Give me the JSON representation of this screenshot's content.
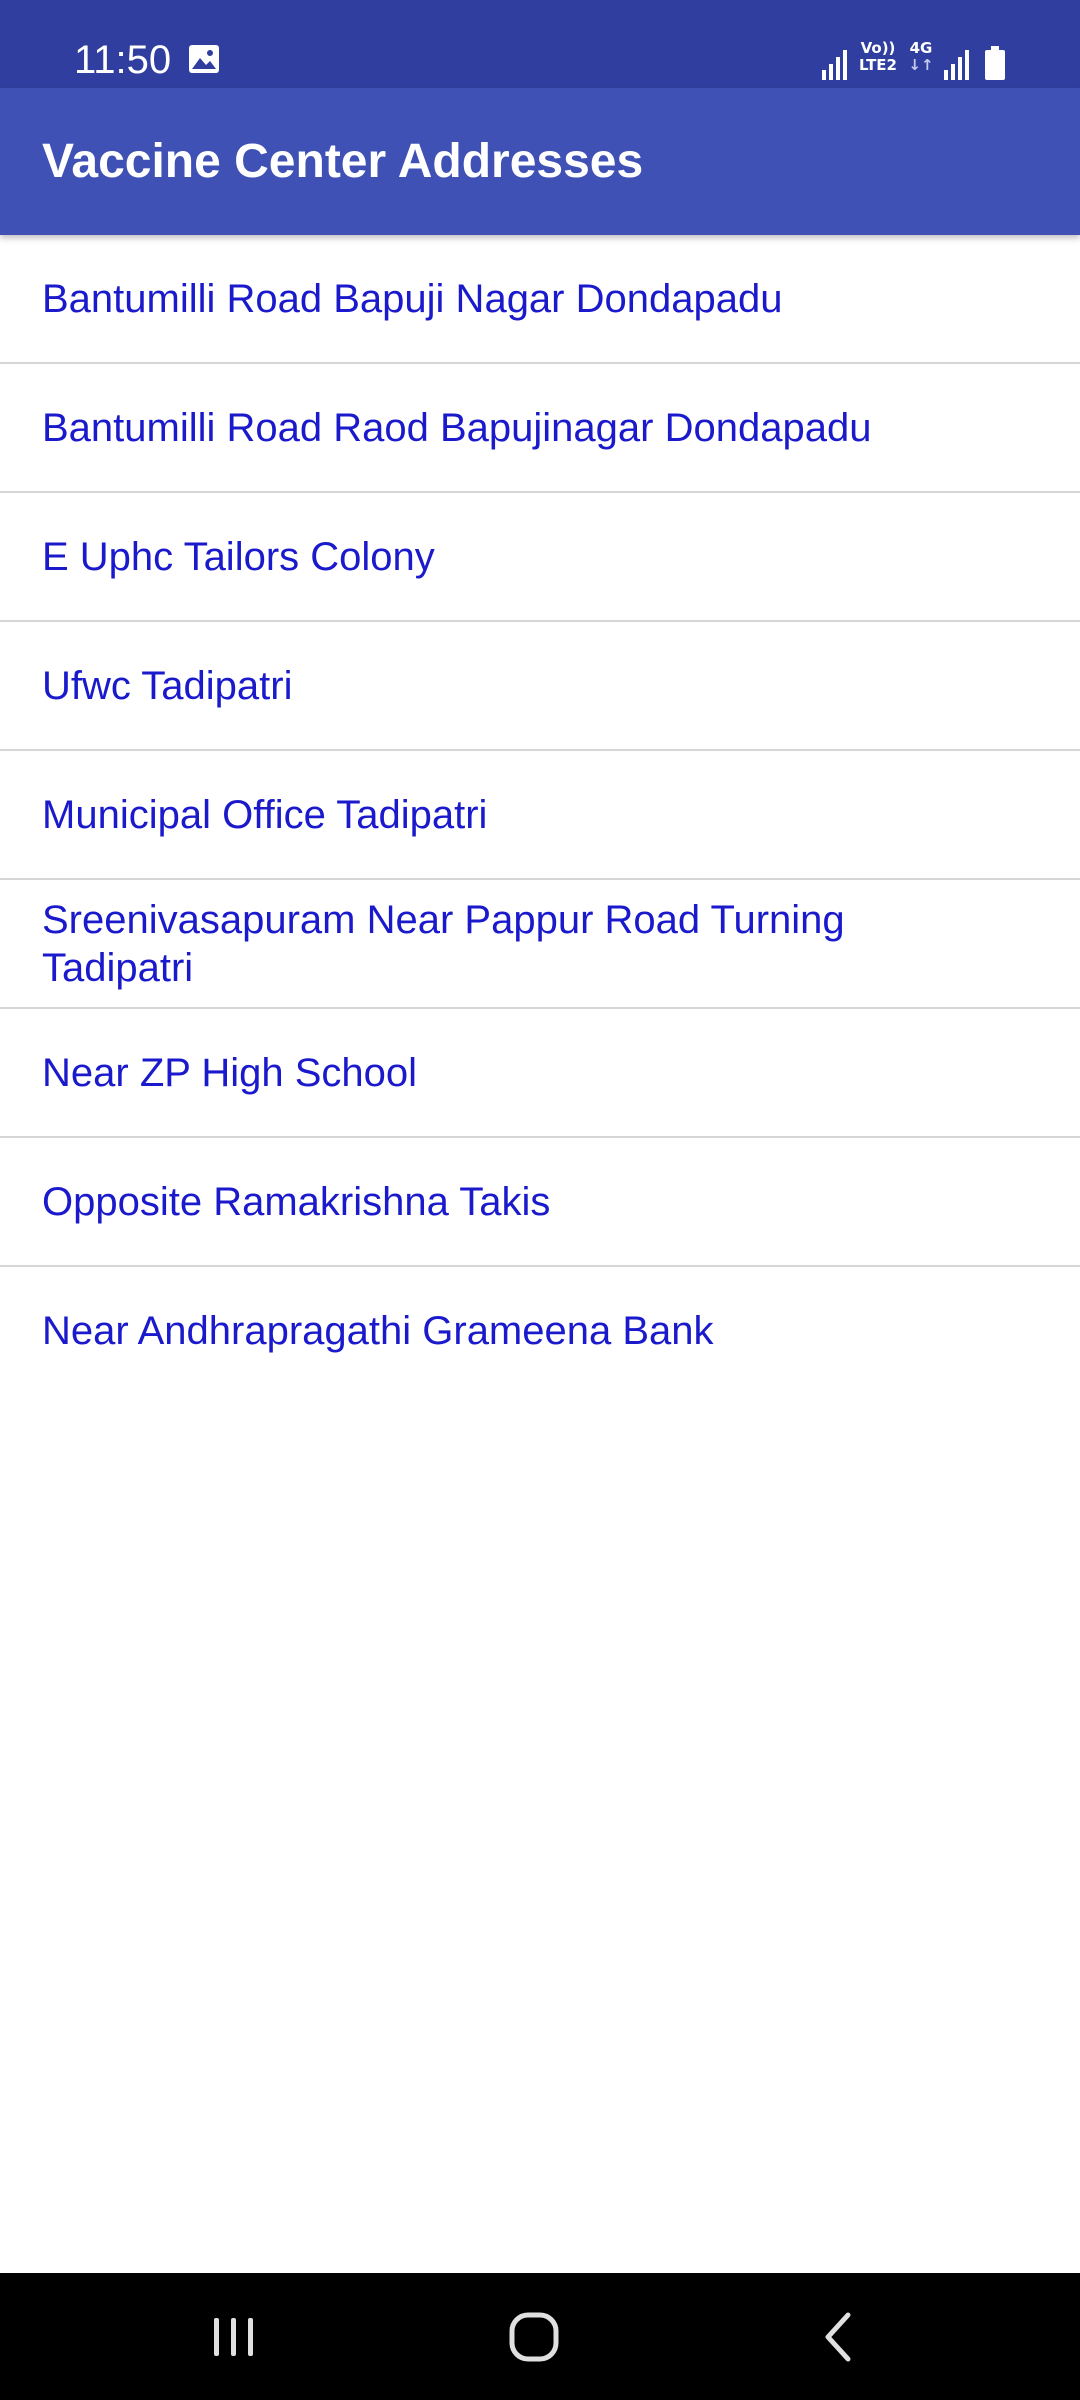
{
  "status_bar": {
    "time": "11:50",
    "icons": [
      "gallery-icon",
      "signal-icon",
      "volte-icon",
      "network-4g-icon",
      "signal-icon",
      "battery-icon"
    ],
    "volte_line1": "Vo))",
    "volte_line2": "LTE2",
    "network_type": "4G",
    "network_arrows": "↓↑"
  },
  "app_bar": {
    "title": "Vaccine Center Addresses"
  },
  "addresses": [
    "Bantumilli Road Bapuji Nagar Dondapadu",
    "Bantumilli Road Raod Bapujinagar Dondapadu",
    "E Uphc Tailors Colony",
    "Ufwc Tadipatri",
    "Municipal Office Tadipatri",
    "Sreenivasapuram Near Pappur Road Turning Tadipatri",
    "Near ZP High School",
    "Opposite Ramakrishna Takis",
    "Near Andhrapragathi Grameena Bank"
  ],
  "nav_bar": {
    "buttons": [
      "recent-apps-icon",
      "home-icon",
      "back-icon"
    ]
  },
  "colors": {
    "status_bar": "#303f9f",
    "app_bar": "#3f51b5",
    "item_text": "#1a1acc",
    "divider": "#d6d6d6",
    "nav_bar": "#000000"
  }
}
